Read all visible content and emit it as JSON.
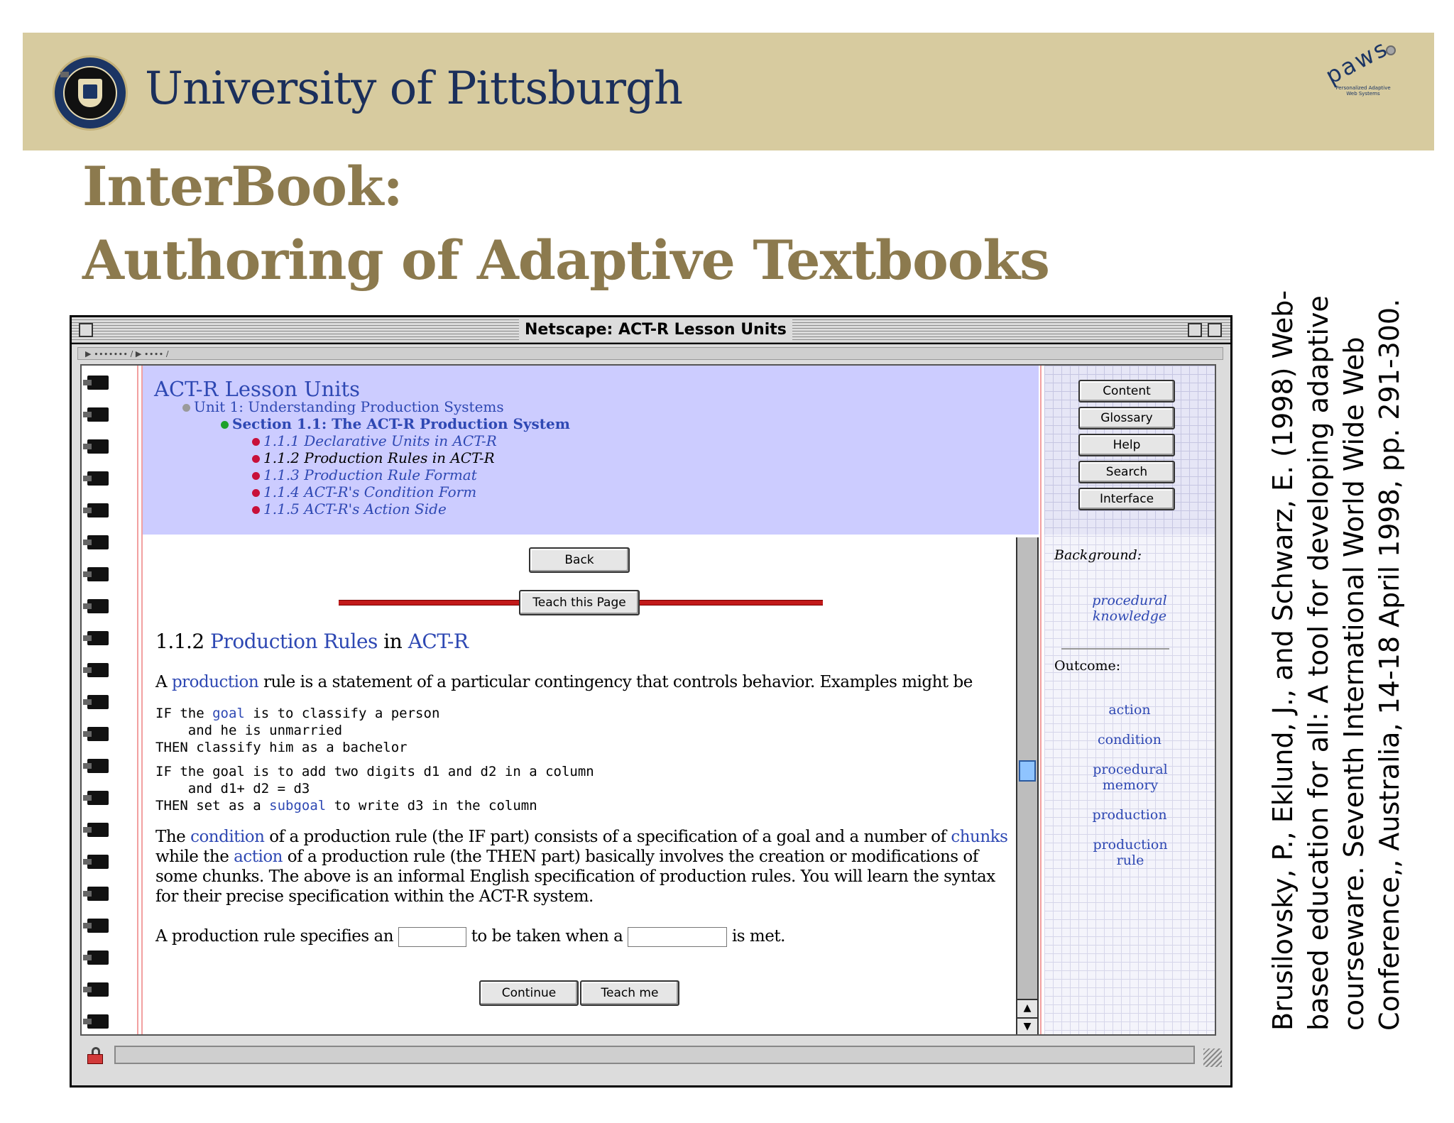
{
  "header": {
    "university_name": "University of Pittsburgh",
    "seal_text": "UNIVERSITY OF PITTSBURGH",
    "logo_text": "paws",
    "logo_subtext": "Personalized Adaptive Web Systems",
    "background_color": "#d7cb9f"
  },
  "slide": {
    "title_line1": "InterBook:",
    "title_line2": "Authoring of Adaptive Textbooks",
    "title_color": "#8c7a4e",
    "citation": "Brusilovsky, P., Eklund, J., and Schwarz, E. (1998) Web-based education for all: A tool for developing adaptive courseware. Seventh International World Wide Web Conference,, Australia, 14-18 April 1998, pp. 291-300."
  },
  "window": {
    "title": "Netscape: ACT-R Lesson Units"
  },
  "toc": {
    "title": "ACT-R Lesson Units",
    "unit": "Unit 1: Understanding Production Systems",
    "section": "Section 1.1: The ACT-R Production System",
    "items": [
      "1.1.1 Declarative Units in ACT-R",
      "1.1.2 Production Rules in ACT-R",
      "1.1.3 Production Rule Format",
      "1.1.4 ACT-R's Condition Form",
      "1.1.5 ACT-R's Action Side"
    ]
  },
  "nav_buttons": [
    "Content",
    "Glossary",
    "Help",
    "Search",
    "Interface"
  ],
  "sidebar": {
    "background_label": "Background:",
    "background_links": [
      "procedural knowledge"
    ],
    "outcome_label": "Outcome:",
    "outcome_links": [
      "action",
      "condition",
      "procedural memory",
      "production",
      "production rule"
    ]
  },
  "main": {
    "back_label": "Back",
    "teach_page_label": "Teach this Page",
    "heading_num": "1.1.2",
    "heading_link1": "Production Rules",
    "heading_in": "in",
    "heading_link2": "ACT-R",
    "para1_a": "A",
    "para1_link": "production",
    "para1_b": "rule is a statement of a particular contingency that controls behavior. Examples might be",
    "code1_l1a": "IF the ",
    "code1_link": "goal",
    "code1_l1b": " is to classify a person",
    "code1_l2": "    and he is unmarried",
    "code1_l3": "THEN classify him as a bachelor",
    "code2_l1": "IF the goal is to add two digits d1 and d2 in a column",
    "code2_l2": "    and d1+ d2 = d3",
    "code2_l3a": "THEN set as a ",
    "code2_link": "subgoal",
    "code2_l3b": " to write d3 in the column",
    "para2_a": "The",
    "para2_link1": "condition",
    "para2_b": "of a production rule (the IF part) consists of a specification of a goal and a number of",
    "para2_link2": "chunks",
    "para2_c": "while the",
    "para2_link3": "action",
    "para2_d": "of a production rule (the THEN part) basically involves the creation or modifications of some chunks. The above is an informal English specification of production rules. You will learn the syntax for their precise specification within the ACT-R system.",
    "quiz_a": "A production rule specifies an",
    "quiz_b": "to be taken when a",
    "quiz_c": "is met.",
    "continue_label": "Continue",
    "teach_me_label": "Teach me"
  }
}
